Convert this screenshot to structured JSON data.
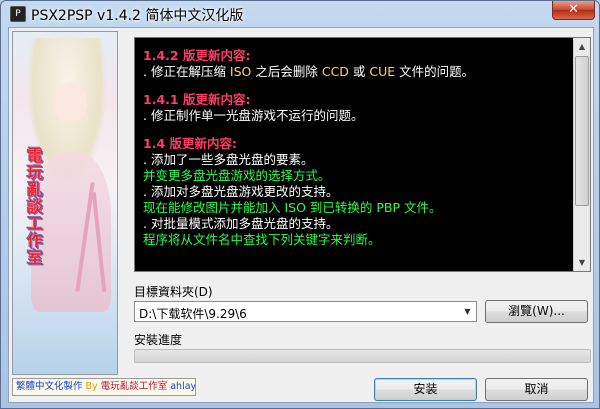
{
  "window": {
    "title": "PSX2PSP v1.4.2 简体中文汉化版",
    "close_label": "✕",
    "app_icon_text": "P"
  },
  "side_image": {
    "logo_text": "電玩亂談工作室"
  },
  "changelog": {
    "sections": [
      {
        "version": "1.4.2 版更新内容:",
        "lines": [
          {
            "parts": [
              ". 修正在解压缩 ",
              "ISO",
              " 之后会删除 ",
              "CCD",
              " 或 ",
              "CUE",
              " 文件的问题。"
            ],
            "color": "white"
          }
        ]
      },
      {
        "version": "1.4.1 版更新内容:",
        "lines": [
          {
            "parts": [
              ". 修正制作单一光盘游戏不运行的问题。"
            ],
            "color": "white"
          }
        ]
      },
      {
        "version": "1.4 版更新内容:",
        "lines": [
          {
            "parts": [
              ". 添加了一些多盘光盘的要素。"
            ],
            "color": "white"
          },
          {
            "parts": [
              "  并变更多盘光盘游戏的选择方式。"
            ],
            "color": "green"
          },
          {
            "parts": [
              ". 添加对多盘光盘游戏更改的支持。"
            ],
            "color": "white"
          },
          {
            "parts": [
              "  现在能修改图片并能加入 ISO 到已转换的 PBP 文件。"
            ],
            "color": "green"
          },
          {
            "parts": [
              ". 对批量模式添加多盘光盘的支持。"
            ],
            "color": "white"
          },
          {
            "parts": [
              "  程序将从文件名中查找下列关键字来判断。"
            ],
            "color": "green"
          }
        ]
      }
    ]
  },
  "target_folder": {
    "label": "目標資料夾(D)",
    "value": "D:\\下载软件\\9.29\\6",
    "browse_label": "瀏覽(W)..."
  },
  "progress": {
    "label": "安裝進度",
    "value": 0
  },
  "credit": {
    "part1": "繁體中文化製作",
    "part2": " By ",
    "part3": "電玩亂談工作室",
    "part4": " ahlay"
  },
  "buttons": {
    "install": "安装",
    "cancel": "取消"
  }
}
